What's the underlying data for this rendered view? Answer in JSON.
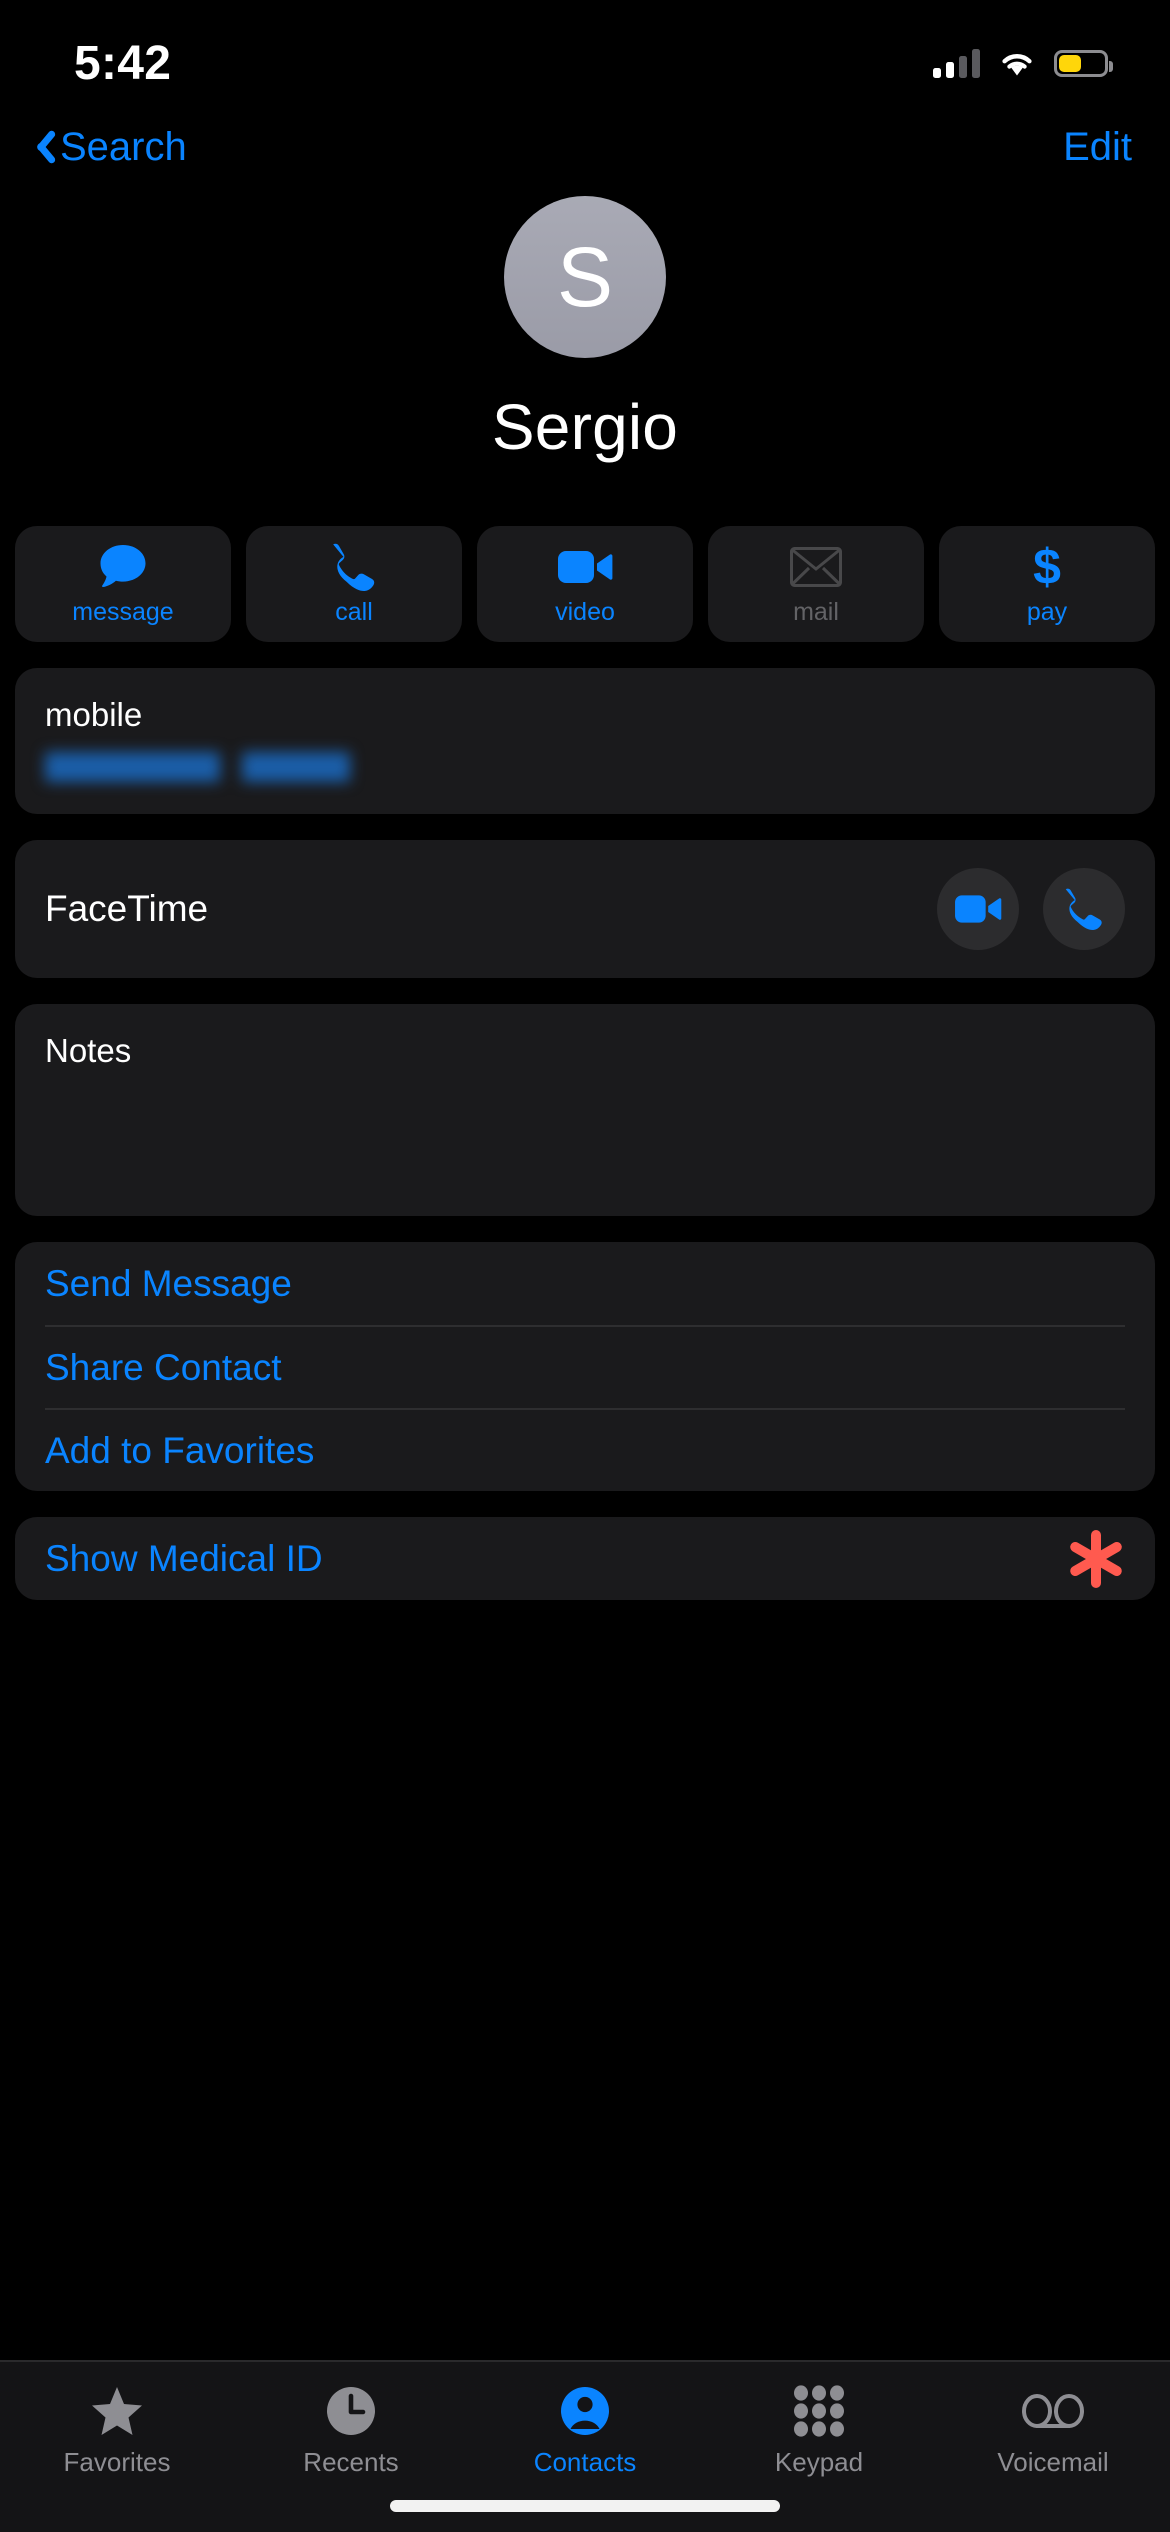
{
  "status_bar": {
    "time": "5:42",
    "cellular_icon": "cellular-bars-icon",
    "cellular_bars_filled": 2,
    "cellular_bars_total": 4,
    "wifi_icon": "wifi-icon",
    "battery_icon": "battery-icon",
    "battery_color": "#ffd60a",
    "battery_level_percent": 45
  },
  "nav_bar": {
    "back_label": "Search",
    "back_icon": "chevron-left-icon",
    "edit_label": "Edit",
    "accent_color": "#0a84ff"
  },
  "contact": {
    "avatar_initial": "S",
    "avatar_color": "#9a9ba7",
    "name": "Sergio"
  },
  "actions": [
    {
      "label": "message",
      "icon": "message-bubble-icon",
      "enabled": true
    },
    {
      "label": "call",
      "icon": "phone-icon",
      "enabled": true
    },
    {
      "label": "video",
      "icon": "video-camera-icon",
      "enabled": true
    },
    {
      "label": "mail",
      "icon": "envelope-icon",
      "enabled": false
    },
    {
      "label": "pay",
      "icon": "dollar-sign-icon",
      "enabled": true
    }
  ],
  "phone_card": {
    "label": "mobile",
    "number": "",
    "number_redacted": true
  },
  "facetime_card": {
    "title": "FaceTime",
    "video_icon": "video-camera-icon",
    "audio_icon": "phone-icon"
  },
  "notes_card": {
    "title": "Notes",
    "body": ""
  },
  "action_list": [
    {
      "label": "Send Message"
    },
    {
      "label": "Share Contact"
    },
    {
      "label": "Add to Favorites"
    }
  ],
  "medical_card": {
    "label": "Show Medical ID",
    "icon": "medical-id-asterisk-icon",
    "icon_color": "#ff5a4f"
  },
  "tab_bar": {
    "active_color": "#0a84ff",
    "inactive_color": "#8e8e93",
    "tabs": [
      {
        "label": "Favorites",
        "icon": "star-icon",
        "active": false
      },
      {
        "label": "Recents",
        "icon": "clock-icon",
        "active": false
      },
      {
        "label": "Contacts",
        "icon": "person-circle-icon",
        "active": true
      },
      {
        "label": "Keypad",
        "icon": "keypad-grid-icon",
        "active": false
      },
      {
        "label": "Voicemail",
        "icon": "voicemail-icon",
        "active": false
      }
    ]
  }
}
